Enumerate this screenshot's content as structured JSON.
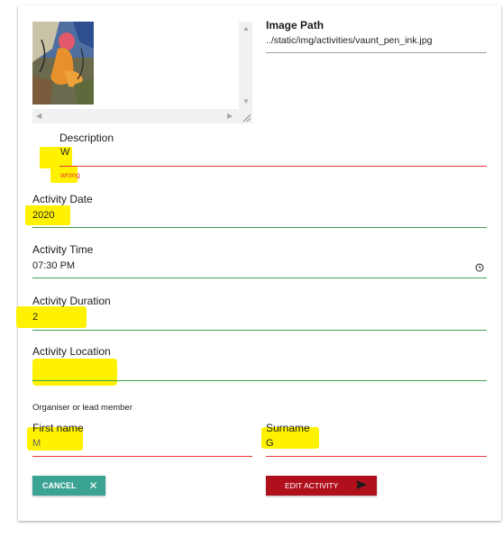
{
  "image": {
    "path_label": "Image Path",
    "path_value": "../static/img/activities/vaunt_pen_ink.jpg"
  },
  "description": {
    "label": "Description",
    "value": "W",
    "error": "wrong"
  },
  "activity_date": {
    "label": "Activity Date",
    "value": "2020"
  },
  "activity_time": {
    "label": "Activity Time",
    "value": "07:30 PM",
    "icon": "clock-icon"
  },
  "activity_duration": {
    "label": "Activity Duration",
    "value": "2"
  },
  "activity_location": {
    "label": "Activity Location",
    "value": ""
  },
  "organiser": {
    "heading": "Organiser or lead member",
    "first_name": {
      "label": "First name",
      "value": "M"
    },
    "surname": {
      "label": "Surname",
      "value": "G"
    }
  },
  "buttons": {
    "cancel": {
      "label": "CANCEL",
      "icon": "close-icon"
    },
    "edit": {
      "label": "EDIT ACTIVITY",
      "icon": "send-icon"
    }
  },
  "colors": {
    "error_line": "#e53935",
    "valid_line": "#43a047",
    "cancel_bg": "#3aa394",
    "edit_bg": "#b0101c",
    "highlight": "#fff200"
  }
}
